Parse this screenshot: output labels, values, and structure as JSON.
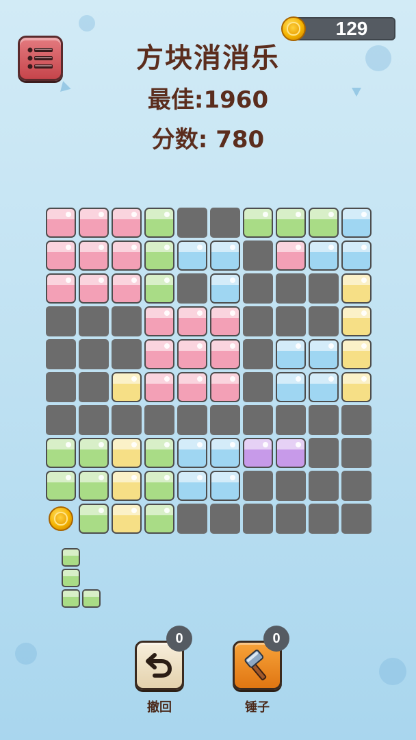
{
  "header": {
    "title": "方块消消乐",
    "best": "最佳:1960",
    "score": "分数: 780",
    "coins": "129"
  },
  "board": {
    "size": 10,
    "grid": [
      [
        "pink",
        "pink",
        "pink",
        "green",
        "empty",
        "empty",
        "green",
        "green",
        "green",
        "blue"
      ],
      [
        "pink",
        "pink",
        "pink",
        "green",
        "blue",
        "blue",
        "empty",
        "pink",
        "blue",
        "blue"
      ],
      [
        "pink",
        "pink",
        "pink",
        "green",
        "empty",
        "blue",
        "empty",
        "empty",
        "empty",
        "yellow"
      ],
      [
        "empty",
        "empty",
        "empty",
        "pink",
        "pink",
        "pink",
        "empty",
        "empty",
        "empty",
        "yellow"
      ],
      [
        "empty",
        "empty",
        "empty",
        "pink",
        "pink",
        "pink",
        "empty",
        "blue",
        "blue",
        "yellow"
      ],
      [
        "empty",
        "empty",
        "yellow",
        "pink",
        "pink",
        "pink",
        "empty",
        "blue",
        "blue",
        "yellow"
      ],
      [
        "empty",
        "empty",
        "empty",
        "empty",
        "empty",
        "empty",
        "empty",
        "empty",
        "empty",
        "empty"
      ],
      [
        "green",
        "green",
        "yellow",
        "green",
        "blue",
        "blue",
        "purple",
        "purple",
        "empty",
        "empty"
      ],
      [
        "green",
        "green",
        "yellow",
        "green",
        "blue",
        "blue",
        "empty",
        "empty",
        "empty",
        "empty"
      ],
      [
        "coin",
        "green",
        "yellow",
        "green",
        "empty",
        "empty",
        "empty",
        "empty",
        "empty",
        "empty"
      ]
    ],
    "colors": {
      "pink": "#f3a0b6",
      "green": "#a9dc86",
      "blue": "#9fd6f2",
      "yellow": "#f6df86",
      "purple": "#c79ae9",
      "empty": "#6c6c6c"
    }
  },
  "next_piece": {
    "color": "green",
    "shape": [
      [
        1,
        0
      ],
      [
        1,
        0
      ],
      [
        1,
        1
      ]
    ]
  },
  "tools": {
    "undo": {
      "label": "撤回",
      "count": "0",
      "icon": "undo-arrow-icon"
    },
    "hammer": {
      "label": "锤子",
      "count": "0",
      "icon": "hammer-icon"
    }
  },
  "icons": {
    "menu": "menu-list-icon",
    "coin": "coin-icon"
  }
}
